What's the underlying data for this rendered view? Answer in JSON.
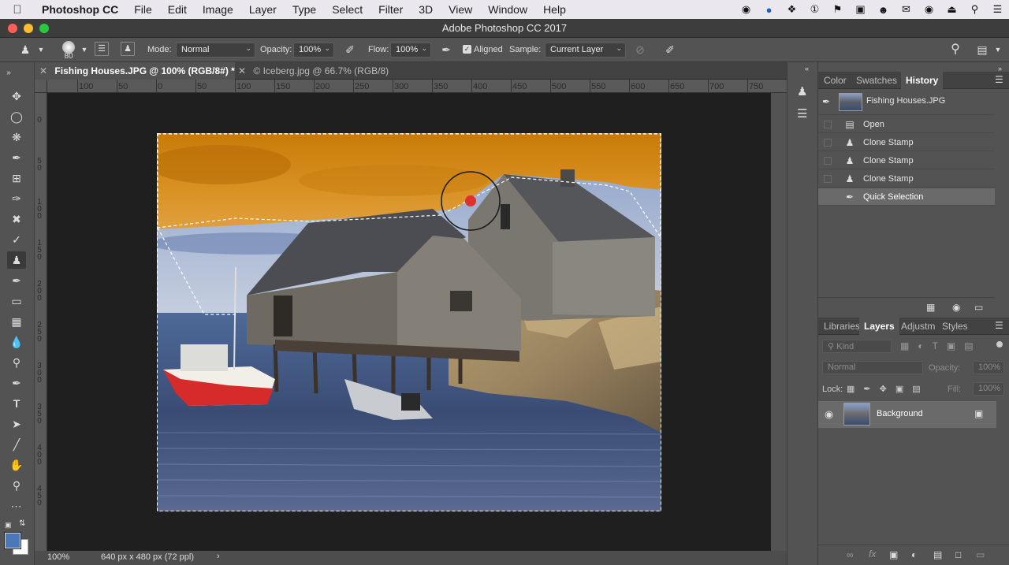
{
  "menubar": {
    "app_name": "Photoshop CC",
    "items": [
      "File",
      "Edit",
      "Image",
      "Layer",
      "Type",
      "Select",
      "Filter",
      "3D",
      "View",
      "Window",
      "Help"
    ],
    "status_icons": [
      "creative-cloud-icon",
      "blue-dot-icon",
      "dropbox-icon",
      "one-password-icon",
      "flag-icon",
      "video-icon",
      "user-icon",
      "speech-icon",
      "search-app-icon",
      "eject-icon",
      "spotlight-icon",
      "list-icon"
    ]
  },
  "window": {
    "title": "Adobe Photoshop CC 2017"
  },
  "options": {
    "brush_size": "80",
    "mode_label": "Mode:",
    "mode_value": "Normal",
    "opacity_label": "Opacity:",
    "opacity_value": "100%",
    "flow_label": "Flow:",
    "flow_value": "100%",
    "aligned_label": "Aligned",
    "sample_label": "Sample:",
    "sample_value": "Current Layer"
  },
  "tabs": [
    {
      "label": "Fishing Houses.JPG @ 100% (RGB/8#) *",
      "active": true
    },
    {
      "label": "© Iceberg.jpg @ 66.7% (RGB/8)",
      "active": false
    }
  ],
  "ruler_top": [
    "100",
    "50",
    "0",
    "50",
    "100",
    "150",
    "200",
    "250",
    "300",
    "350",
    "400",
    "450",
    "500",
    "550",
    "600",
    "650",
    "700",
    "750"
  ],
  "ruler_left": [
    [
      "0"
    ],
    [
      "5",
      "0"
    ],
    [
      "1",
      "0",
      "0"
    ],
    [
      "1",
      "5",
      "0"
    ],
    [
      "2",
      "0",
      "0"
    ],
    [
      "2",
      "5",
      "0"
    ],
    [
      "3",
      "0",
      "0"
    ],
    [
      "3",
      "5",
      "0"
    ],
    [
      "4",
      "0",
      "0"
    ],
    [
      "4",
      "5",
      "0"
    ]
  ],
  "status": {
    "zoom": "100%",
    "doc_info": "640 px x 480 px (72 ppl)"
  },
  "history_panel": {
    "tabs": [
      "Color",
      "Swatches",
      "History"
    ],
    "snapshot": "Fishing Houses.JPG",
    "items": [
      {
        "label": "Open",
        "icon": "document-icon"
      },
      {
        "label": "Clone Stamp",
        "icon": "clone-stamp-icon"
      },
      {
        "label": "Clone Stamp",
        "icon": "clone-stamp-icon"
      },
      {
        "label": "Clone Stamp",
        "icon": "clone-stamp-icon"
      },
      {
        "label": "Quick Selection",
        "icon": "quick-selection-icon"
      }
    ]
  },
  "layers_panel": {
    "tabs": [
      "Libraries",
      "Layers",
      "Adjustm",
      "Styles"
    ],
    "kind_placeholder": "Kind",
    "blend_mode": "Normal",
    "opacity_label": "Opacity:",
    "opacity_value": "100%",
    "lock_label": "Lock:",
    "fill_label": "Fill:",
    "fill_value": "100%",
    "layers": [
      {
        "name": "Background",
        "visible": true,
        "locked": true
      }
    ]
  },
  "colors": {
    "selection_accent": "#e03030",
    "foreground": "#4a78b8",
    "background": "#ffffff"
  }
}
